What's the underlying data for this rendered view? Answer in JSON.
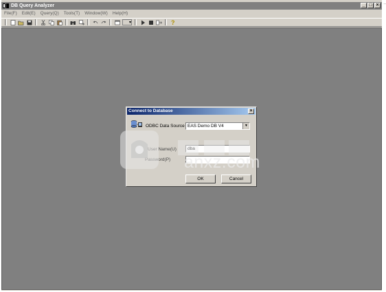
{
  "window": {
    "title": "DB Query Analyzer",
    "controls": [
      "_",
      "□",
      "×"
    ]
  },
  "menu": [
    "File(F)",
    "Edit(E)",
    "Query(Q)",
    "Tools(T)",
    "Window(W)",
    "Help(H)"
  ],
  "toolbar": {
    "icons": [
      "new-icon",
      "open-icon",
      "save-icon",
      "cut-icon",
      "copy-icon",
      "paste-icon",
      "find-icon",
      "replace-icon",
      "undo-icon",
      "redo-icon",
      "results-grid-icon",
      "execute-icon",
      "stop-icon",
      "parse-icon",
      "help-icon"
    ]
  },
  "dialog": {
    "title": "Connect to Database",
    "data_source_label": "ODBC Data Source",
    "data_source_value": "EAS Demo DB V4",
    "user_name_label": "User Name(U)",
    "user_name_value": "dba",
    "password_label": "Password(P)",
    "password_value": "",
    "ok_label": "OK",
    "cancel_label": "Cancel"
  },
  "watermark": {
    "text": "anxz.com"
  },
  "colors": {
    "workspace": "#808080",
    "chrome": "#d4d0c8",
    "dialog_title": "#0a246a"
  }
}
